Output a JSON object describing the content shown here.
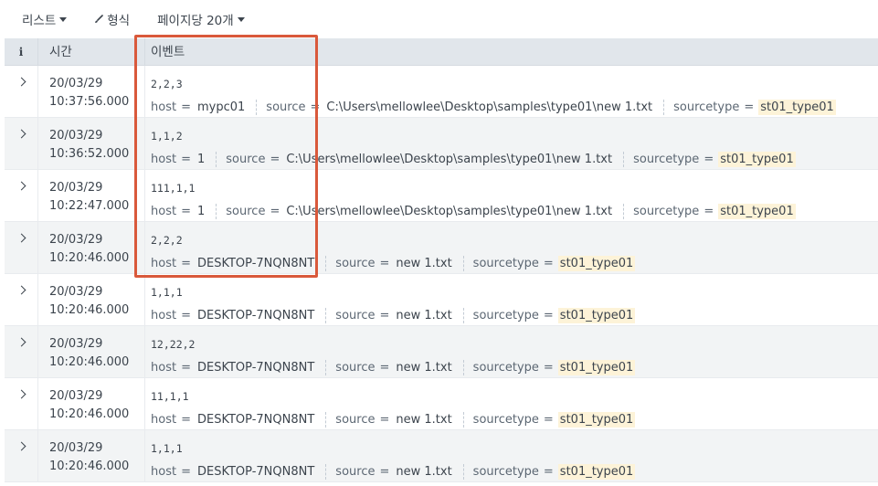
{
  "toolbar": {
    "list_label": "리스트",
    "format_label": "형식",
    "per_page_label": "페이지당 20개"
  },
  "table": {
    "headers": {
      "info": "i",
      "time": "시간",
      "event": "이벤트"
    },
    "field_keys": {
      "host": "host",
      "source": "source",
      "sourcetype": "sourcetype"
    },
    "equals": "=",
    "rows": [
      {
        "date": "20/03/29",
        "time": "10:37:56.000",
        "raw": "2,2,3",
        "host": "mypc01",
        "source": "C:\\Users\\mellowlee\\Desktop\\samples\\type01\\new 1.txt",
        "sourcetype": "st01_type01"
      },
      {
        "date": "20/03/29",
        "time": "10:36:52.000",
        "raw": "1,1,2",
        "host": "1",
        "source": "C:\\Users\\mellowlee\\Desktop\\samples\\type01\\new 1.txt",
        "sourcetype": "st01_type01"
      },
      {
        "date": "20/03/29",
        "time": "10:22:47.000",
        "raw": "111,1,1",
        "host": "1",
        "source": "C:\\Users\\mellowlee\\Desktop\\samples\\type01\\new 1.txt",
        "sourcetype": "st01_type01"
      },
      {
        "date": "20/03/29",
        "time": "10:20:46.000",
        "raw": "2,2,2",
        "host": "DESKTOP-7NQN8NT",
        "source": "new 1.txt",
        "sourcetype": "st01_type01"
      },
      {
        "date": "20/03/29",
        "time": "10:20:46.000",
        "raw": "1,1,1",
        "host": "DESKTOP-7NQN8NT",
        "source": "new 1.txt",
        "sourcetype": "st01_type01"
      },
      {
        "date": "20/03/29",
        "time": "10:20:46.000",
        "raw": "12,22,2",
        "host": "DESKTOP-7NQN8NT",
        "source": "new 1.txt",
        "sourcetype": "st01_type01"
      },
      {
        "date": "20/03/29",
        "time": "10:20:46.000",
        "raw": "11,1,1",
        "host": "DESKTOP-7NQN8NT",
        "source": "new 1.txt",
        "sourcetype": "st01_type01"
      },
      {
        "date": "20/03/29",
        "time": "10:20:46.000",
        "raw": "1,1,1",
        "host": "DESKTOP-7NQN8NT",
        "source": "new 1.txt",
        "sourcetype": "st01_type01"
      }
    ]
  },
  "colors": {
    "annotation_box": "#d9593b",
    "sourcetype_highlight": "#fdf3d8",
    "header_bg": "#e1e6eb",
    "alt_row_bg": "#f2f4f5"
  }
}
